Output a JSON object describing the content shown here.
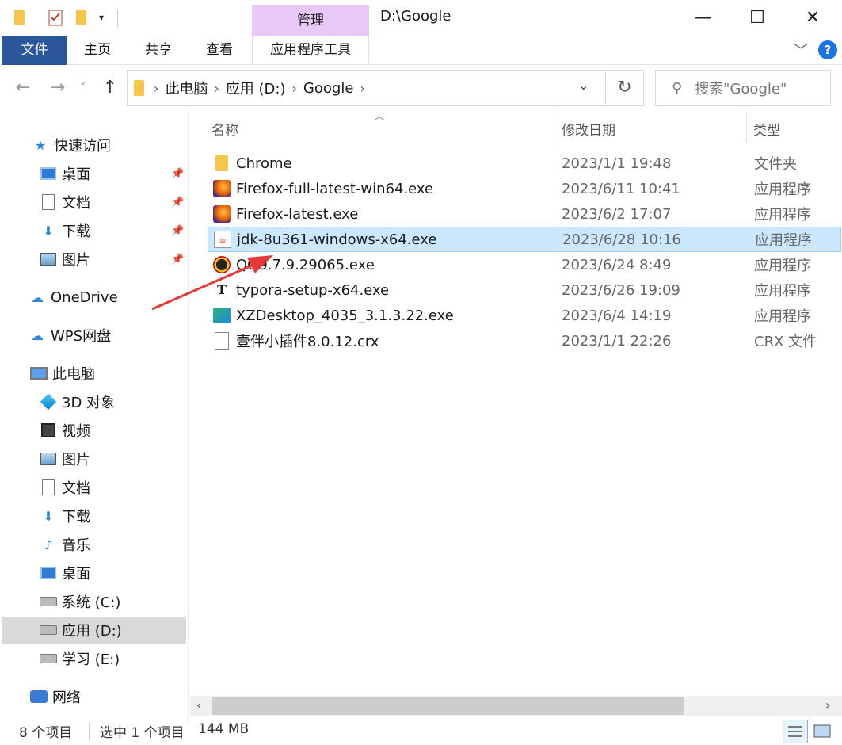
{
  "window": {
    "title": "D:\\Google",
    "minimize": "—",
    "maximize": "☐",
    "close": "✕"
  },
  "ribbon": {
    "context_tab": "管理",
    "tabs": [
      "文件",
      "主页",
      "共享",
      "查看",
      "应用程序工具"
    ],
    "help": "?"
  },
  "address": {
    "crumbs": [
      "此电脑",
      "应用 (D:)",
      "Google"
    ],
    "search_placeholder": "搜索\"Google\""
  },
  "sidebar": {
    "quick_access": "快速访问",
    "quick_items": [
      "桌面",
      "文档",
      "下载",
      "图片"
    ],
    "onedrive": "OneDrive",
    "wps": "WPS网盘",
    "this_pc": "此电脑",
    "pc_items": [
      "3D 对象",
      "视频",
      "图片",
      "文档",
      "下载",
      "音乐",
      "桌面",
      "系统 (C:)",
      "应用 (D:)",
      "学习 (E:)"
    ],
    "network": "网络"
  },
  "columns": {
    "name": "名称",
    "date": "修改日期",
    "type": "类型"
  },
  "files": [
    {
      "name": "Chrome",
      "date": "2023/1/1 19:48",
      "type": "文件夹",
      "icon": "folder-icon"
    },
    {
      "name": "Firefox-full-latest-win64.exe",
      "date": "2023/6/11 10:41",
      "type": "应用程序",
      "icon": "firefox-icon"
    },
    {
      "name": "Firefox-latest.exe",
      "date": "2023/6/2 17:07",
      "type": "应用程序",
      "icon": "firefox-icon"
    },
    {
      "name": "jdk-8u361-windows-x64.exe",
      "date": "2023/6/28 10:16",
      "type": "应用程序",
      "icon": "java-icon"
    },
    {
      "name": "QQ9.7.9.29065.exe",
      "date": "2023/6/24 8:49",
      "type": "应用程序",
      "icon": "qq-icon"
    },
    {
      "name": "typora-setup-x64.exe",
      "date": "2023/6/26 19:09",
      "type": "应用程序",
      "icon": "typora-icon"
    },
    {
      "name": "XZDesktop_4035_3.1.3.22.exe",
      "date": "2023/6/4 14:19",
      "type": "应用程序",
      "icon": "xzdesktop-icon"
    },
    {
      "name": "壹伴小插件8.0.12.crx",
      "date": "2023/1/1 22:26",
      "type": "CRX 文件",
      "icon": "file-icon"
    }
  ],
  "status": {
    "count": "8 个项目",
    "selected": "选中 1 个项目",
    "size": "144 MB"
  },
  "colors": {
    "file_tab": "#2b579a",
    "manage_tab": "#e8c8f6",
    "selection": "#cce8ff",
    "annotation_arrow": "#e53935"
  }
}
